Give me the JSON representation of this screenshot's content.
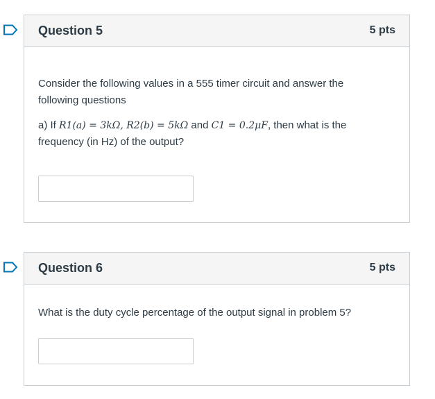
{
  "questions": [
    {
      "title": "Question 5",
      "points": "5 pts",
      "intro": "Consider the following values in a 555 timer circuit and answer the following questions",
      "part_a": {
        "prefix": "a) If ",
        "r1": "R1(a) = 3kΩ, ",
        "r2": "R2(b) = 5kΩ",
        "and": " and ",
        "c1": "C1 = 0.2μF",
        "suffix": ", then what is the frequency (in Hz) of the output?"
      },
      "answer_value": "",
      "flag_icon": "bookmark-flag-icon"
    },
    {
      "title": "Question 6",
      "points": "5 pts",
      "prompt": "What is the duty cycle percentage of the output signal in problem 5?",
      "answer_value": "",
      "flag_icon": "bookmark-flag-icon"
    }
  ],
  "colors": {
    "flag": "#0374b5",
    "header_bg": "#f5f5f5",
    "border": "#c7cdd1",
    "text": "#2d3b45"
  }
}
